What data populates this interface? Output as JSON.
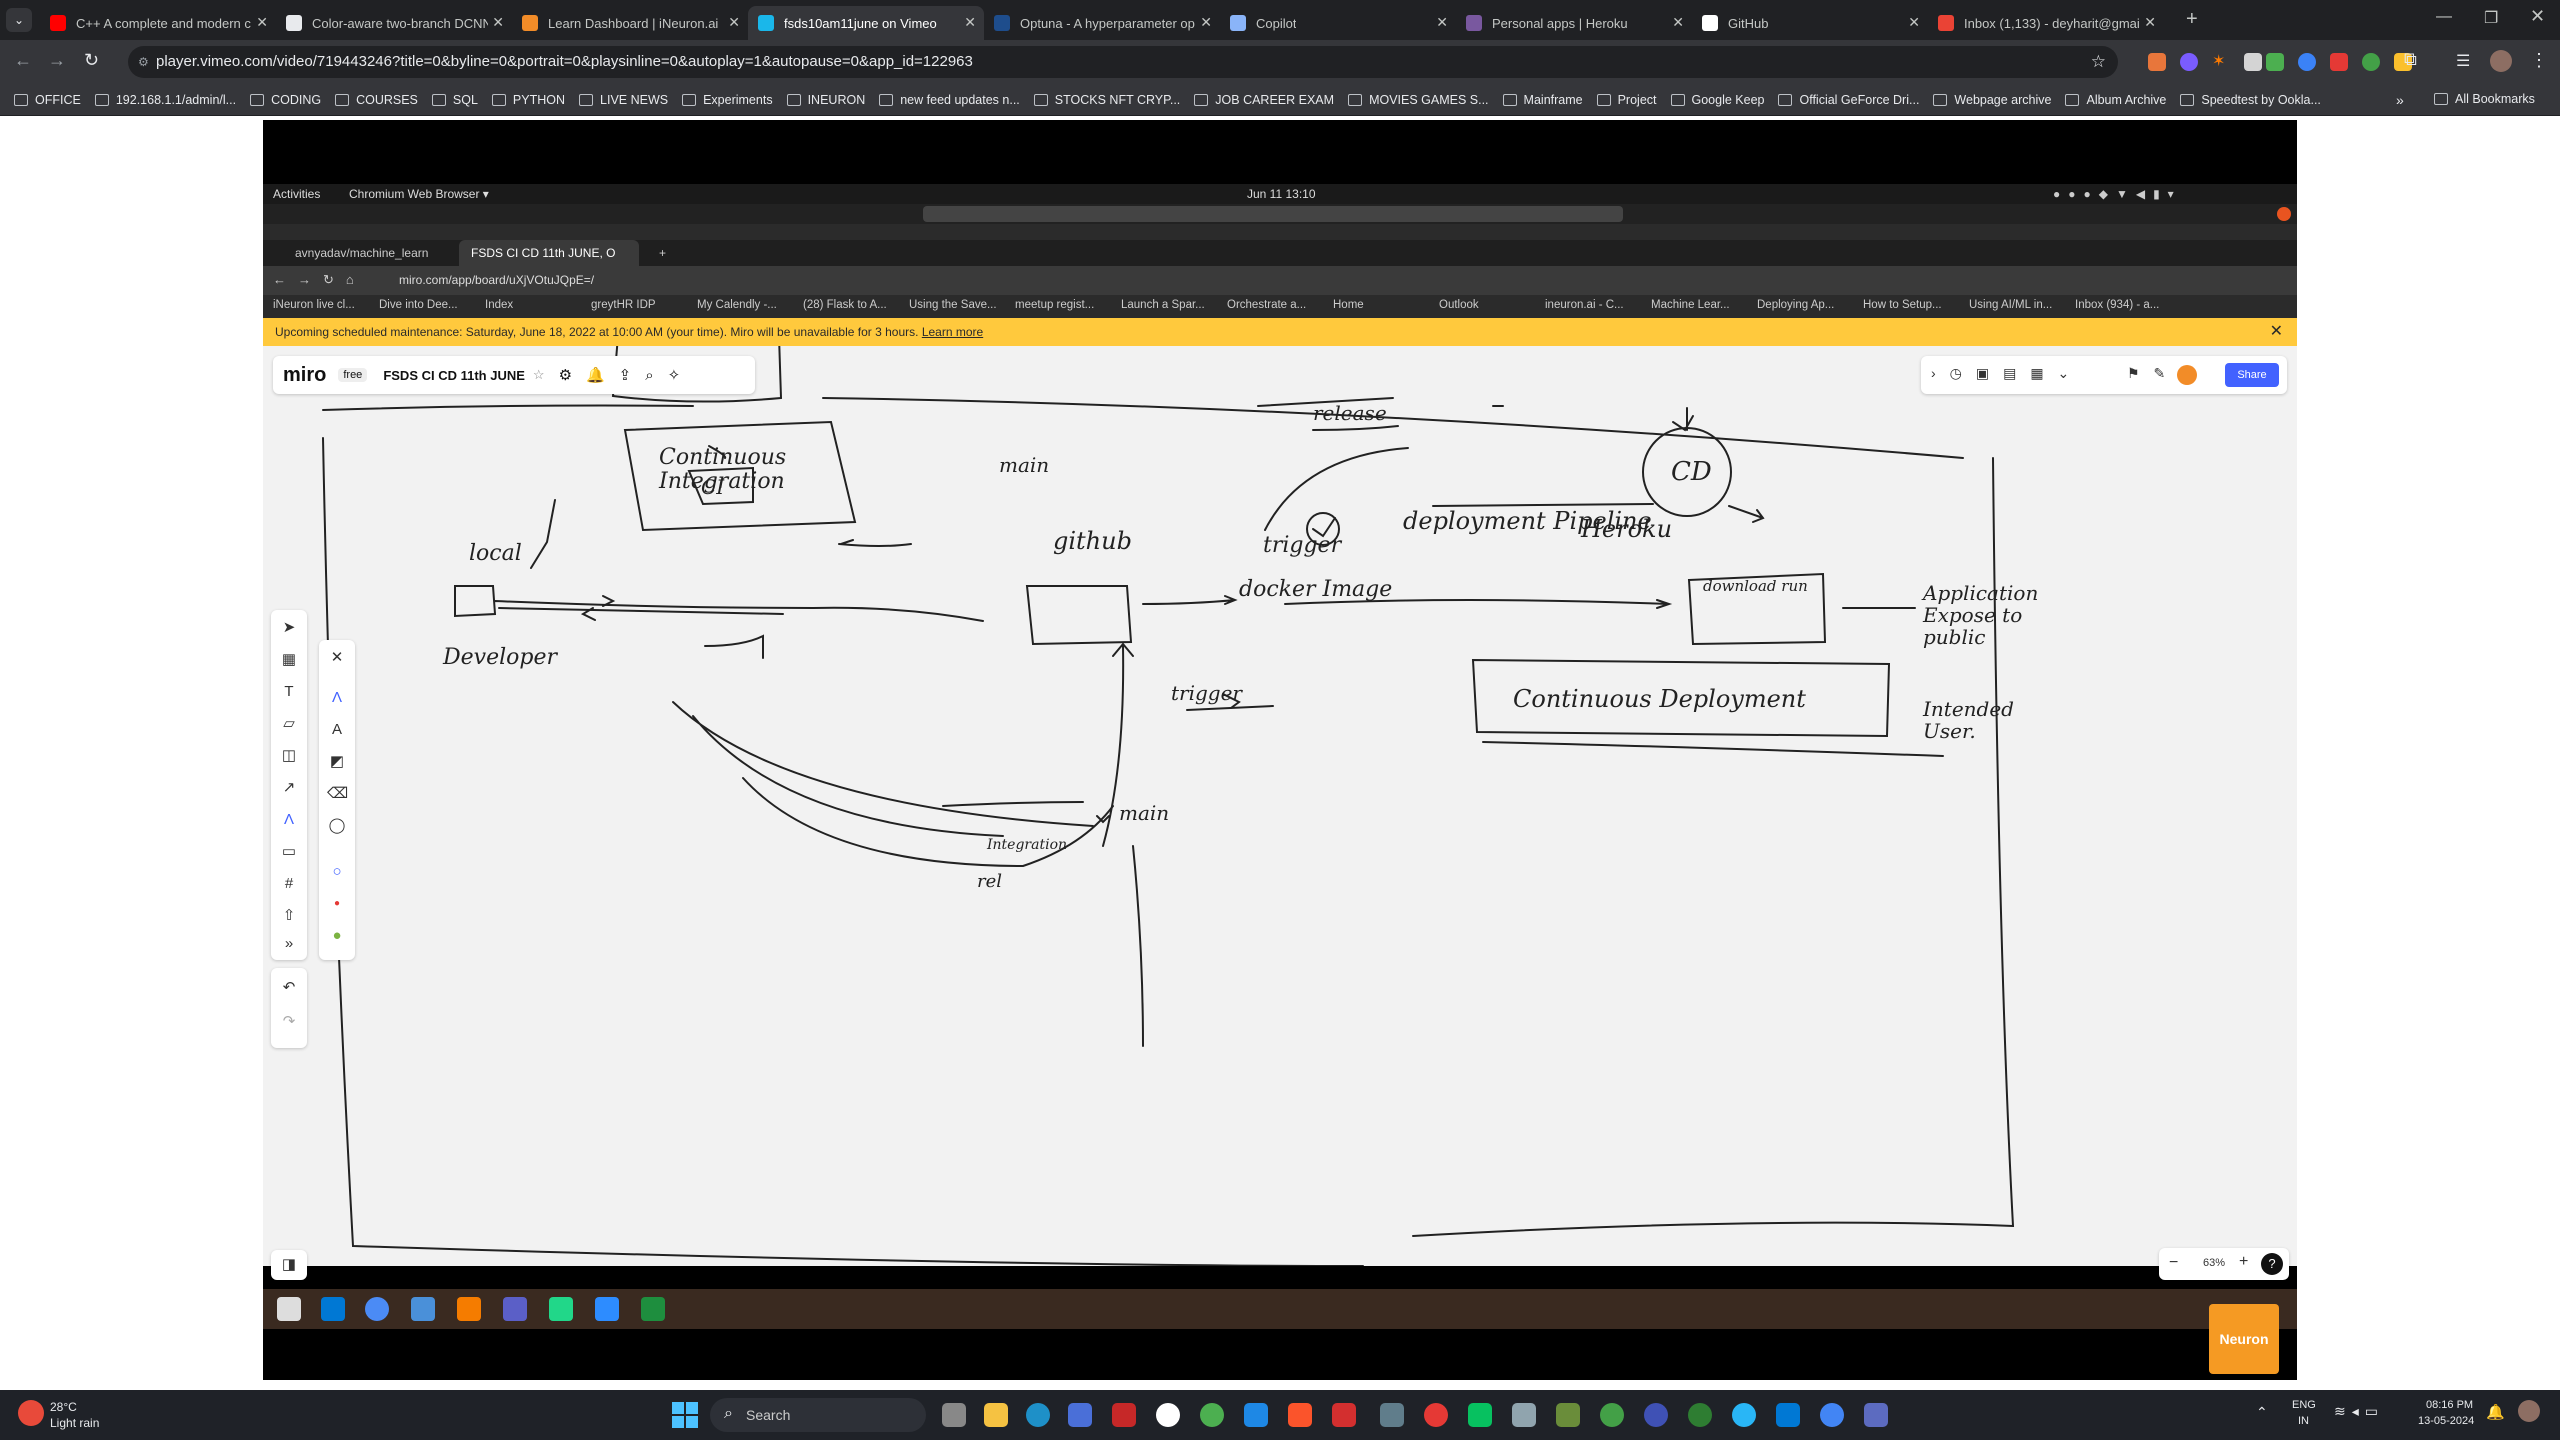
{
  "browser": {
    "tabs": [
      {
        "title": "C++ A complete and modern c",
        "icon": "youtube-icon",
        "color": "#ff0000"
      },
      {
        "title": "Color-aware two-branch DCNN",
        "icon": "document-icon",
        "color": "#e8eaed"
      },
      {
        "title": "Learn Dashboard | iNeuron.ai",
        "icon": "ineuron-icon",
        "color": "#f28c28"
      },
      {
        "title": "fsds10am11june on Vimeo",
        "icon": "vimeo-icon",
        "color": "#1ab7ea"
      },
      {
        "title": "Optuna - A hyperparameter op",
        "icon": "optuna-icon",
        "color": "#1e4d8c"
      },
      {
        "title": "Copilot",
        "icon": "copilot-icon",
        "color": "#8ab4f8"
      },
      {
        "title": "Personal apps | Heroku",
        "icon": "heroku-icon",
        "color": "#79589f"
      },
      {
        "title": "GitHub",
        "icon": "github-icon",
        "color": "#ffffff"
      },
      {
        "title": "Inbox (1,133) - deyharit@gmail",
        "icon": "gmail-icon",
        "color": "#ea4335"
      }
    ],
    "url": "player.vimeo.com/video/719443246?title=0&byline=0&portrait=0&playsinline=0&autoplay=1&autopause=0&app_id=122963",
    "bookmarks": [
      "OFFICE",
      "192.168.1.1/admin/l...",
      "CODING",
      "COURSES",
      "SQL",
      "PYTHON",
      "LIVE NEWS",
      "Experiments",
      "INEURON",
      "new feed updates n...",
      "STOCKS NFT CRYP...",
      "JOB CAREER EXAM",
      "MOVIES GAMES S...",
      "Mainframe",
      "Project",
      "Google Keep",
      "Official GeForce Dri...",
      "Webpage archive",
      "Album Archive",
      "Speedtest by Ookla..."
    ],
    "all_bookmarks": "All Bookmarks"
  },
  "video": {
    "ubuntu_bar": {
      "activities": "Activities",
      "app": "Chromium Web Browser ▾",
      "clock": "Jun 11  13:10"
    },
    "inner_tabs": [
      "avnyadav/machine_learn",
      "FSDS CI CD 11th JUNE, O"
    ],
    "inner_url": "miro.com/app/board/uXjVOtuJQpE=/",
    "inner_bookmarks": [
      "iNeuron live cl...",
      "Dive into Dee...",
      "Index",
      "greytHR IDP",
      "My Calendly -...",
      "(28) Flask to A...",
      "Using the Save...",
      "meetup regist...",
      "Launch a Spar...",
      "Orchestrate a...",
      "Home",
      "Outlook",
      "ineuron.ai - C...",
      "Machine Lear...",
      "Deploying Ap...",
      "How to Setup...",
      "Using AI/ML in...",
      "Inbox (934) - a..."
    ],
    "banner": {
      "text": "Upcoming scheduled maintenance: Saturday, June 18, 2022 at 10:00 AM (your time). Miro will be unavailable for 3 hours.",
      "link": "Learn more"
    },
    "miro": {
      "logo": "miro",
      "plan": "free",
      "board_title": "FSDS CI CD 11th JUNE",
      "share": "Share",
      "zoom": "63%"
    },
    "sketch_labels": {
      "ci_box": "Continuous Integration",
      "ci": "CI",
      "local": "local",
      "developer": "Developer",
      "main_top": "main",
      "github": "github",
      "trigger1": "trigger",
      "release": "release",
      "cd": "CD",
      "pipeline": "deployment Pipeline",
      "heroku": "Heroku",
      "download_run": "download run",
      "docker": "docker Image",
      "trigger2": "trigger",
      "app": "Application Expose to public",
      "intended": "Intended User.",
      "cd_box": "Continuous Deployment",
      "main_bottom": "main",
      "integration": "Integration",
      "rel": "rel"
    },
    "watermark": "Neuron"
  },
  "taskbar": {
    "weather_temp": "28°C",
    "weather_desc": "Light rain",
    "search": "Search",
    "lang": "ENG",
    "region": "IN",
    "time": "08:16 PM",
    "date": "13-05-2024"
  }
}
